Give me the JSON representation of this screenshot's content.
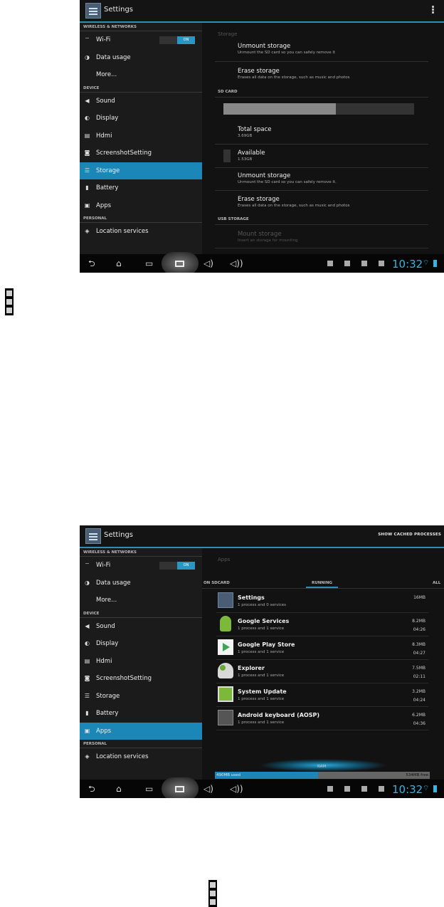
{
  "screens": [
    {
      "action_title": "Settings",
      "sidebar": {
        "sections": [
          "WIRELESS & NETWORKS",
          "DEVICE",
          "PERSONAL"
        ],
        "items": [
          {
            "label": "Wi-Fi",
            "icon": "wifi-icon"
          },
          {
            "label": "Data usage",
            "icon": "data-usage-icon"
          },
          {
            "label": "More...",
            "icon": ""
          },
          {
            "label": "Sound",
            "icon": "sound-icon"
          },
          {
            "label": "Display",
            "icon": "display-icon"
          },
          {
            "label": "Hdmi",
            "icon": "hdmi-icon"
          },
          {
            "label": "ScreenshotSetting",
            "icon": "camera-icon"
          },
          {
            "label": "Storage",
            "icon": "storage-icon"
          },
          {
            "label": "Battery",
            "icon": "battery-icon"
          },
          {
            "label": "Apps",
            "icon": "apps-icon"
          },
          {
            "label": "Location services",
            "icon": "location-icon"
          }
        ],
        "wifi_toggle": "ON",
        "selected": "Storage"
      },
      "content": {
        "header": "Storage",
        "top_row": {
          "title": "Unmount storage",
          "sub": "Unmount the SD card so you can safely remove it"
        },
        "erase1": {
          "title": "Erase storage",
          "sub": "Erases all data on the storage, such as music and photos"
        },
        "sd_section": "SD CARD",
        "sd_used_fraction": 0.59,
        "total": {
          "title": "Total space",
          "sub": "3.69GB"
        },
        "available": {
          "title": "Available",
          "sub": "1.53GB"
        },
        "unmount": {
          "title": "Unmount storage",
          "sub": "Unmount the SD card so you can safely remove it."
        },
        "erase2": {
          "title": "Erase storage",
          "sub": "Erases all data on the storage, such as music and photos"
        },
        "usb_section": "USB STORAGE",
        "mount": {
          "title": "Mount storage",
          "sub": "Insert an storage for mounting"
        }
      },
      "clock": "10:32"
    },
    {
      "action_title": "Settings",
      "action_right": "SHOW CACHED PROCESSES",
      "sidebar": {
        "sections": [
          "WIRELESS & NETWORKS",
          "DEVICE",
          "PERSONAL"
        ],
        "items": [
          {
            "label": "Wi-Fi",
            "icon": "wifi-icon"
          },
          {
            "label": "Data usage",
            "icon": "data-usage-icon"
          },
          {
            "label": "More...",
            "icon": ""
          },
          {
            "label": "Sound",
            "icon": "sound-icon"
          },
          {
            "label": "Display",
            "icon": "display-icon"
          },
          {
            "label": "Hdmi",
            "icon": "hdmi-icon"
          },
          {
            "label": "ScreenshotSetting",
            "icon": "camera-icon"
          },
          {
            "label": "Storage",
            "icon": "storage-icon"
          },
          {
            "label": "Battery",
            "icon": "battery-icon"
          },
          {
            "label": "Apps",
            "icon": "apps-icon"
          },
          {
            "label": "Location services",
            "icon": "location-icon"
          }
        ],
        "wifi_toggle": "ON",
        "selected": "Apps"
      },
      "content": {
        "header": "Apps",
        "tabs": [
          "ON SDCARD",
          "RUNNING",
          "ALL"
        ],
        "apps": [
          {
            "name": "Settings",
            "process": "1 process and 0 services",
            "size": "16MB",
            "time": "",
            "icon": "settings-app-icon"
          },
          {
            "name": "Google Services",
            "process": "1 process and 1 service",
            "size": "8.2MB",
            "time": "04:26",
            "icon": "android-icon"
          },
          {
            "name": "Google Play Store",
            "process": "1 process and 1 service",
            "size": "8.3MB",
            "time": "04:27",
            "icon": "play-store-icon"
          },
          {
            "name": "Explorer",
            "process": "1 process and 1 service",
            "size": "7.5MB",
            "time": "02:11",
            "icon": "explorer-icon"
          },
          {
            "name": "System Update",
            "process": "1 process and 1 service",
            "size": "3.2MB",
            "time": "04:24",
            "icon": "system-update-icon"
          },
          {
            "name": "Android keyboard (AOSP)",
            "process": "1 process and 1 service",
            "size": "6.2MB",
            "time": "04:36",
            "icon": "keyboard-icon"
          }
        ],
        "ram_label": "RAM",
        "ram_used": "490MB used",
        "ram_free": "534MB free",
        "ram_used_fraction": 0.48
      },
      "clock": "10:32"
    }
  ],
  "colors": {
    "accent": "#33b5e5",
    "selected": "#1b87b8",
    "background": "#0d0d0d"
  }
}
